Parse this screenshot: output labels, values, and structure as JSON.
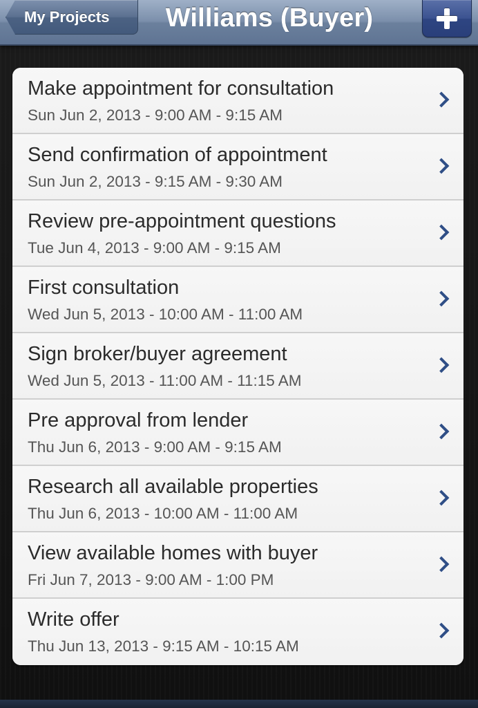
{
  "navbar": {
    "back_label": "My Projects",
    "title": "Williams (Buyer)",
    "add_icon": "plus-icon"
  },
  "colors": {
    "navbar": "#7b8fab",
    "add_button": "#3b5290",
    "chevron": "#2f4e86",
    "list_background": "#f4f4f4"
  },
  "tasks": [
    {
      "title": "Make appointment for consultation",
      "time": "Sun Jun 2, 2013 - 9:00 AM - 9:15 AM"
    },
    {
      "title": "Send confirmation of appointment",
      "time": "Sun Jun 2, 2013 - 9:15 AM - 9:30 AM"
    },
    {
      "title": "Review pre-appointment questions",
      "time": "Tue Jun 4, 2013 - 9:00 AM - 9:15 AM"
    },
    {
      "title": "First consultation",
      "time": "Wed Jun 5, 2013 - 10:00 AM - 11:00 AM"
    },
    {
      "title": "Sign broker/buyer agreement",
      "time": "Wed Jun 5, 2013 - 11:00 AM - 11:15 AM"
    },
    {
      "title": "Pre approval from lender",
      "time": "Thu Jun 6, 2013 - 9:00 AM - 9:15 AM"
    },
    {
      "title": "Research all available properties",
      "time": "Thu Jun 6, 2013 - 10:00 AM - 11:00 AM"
    },
    {
      "title": "View available homes with buyer",
      "time": "Fri Jun 7, 2013 - 9:00 AM - 1:00 PM"
    },
    {
      "title": "Write offer",
      "time": "Thu Jun 13, 2013 - 9:15 AM - 10:15 AM"
    }
  ]
}
